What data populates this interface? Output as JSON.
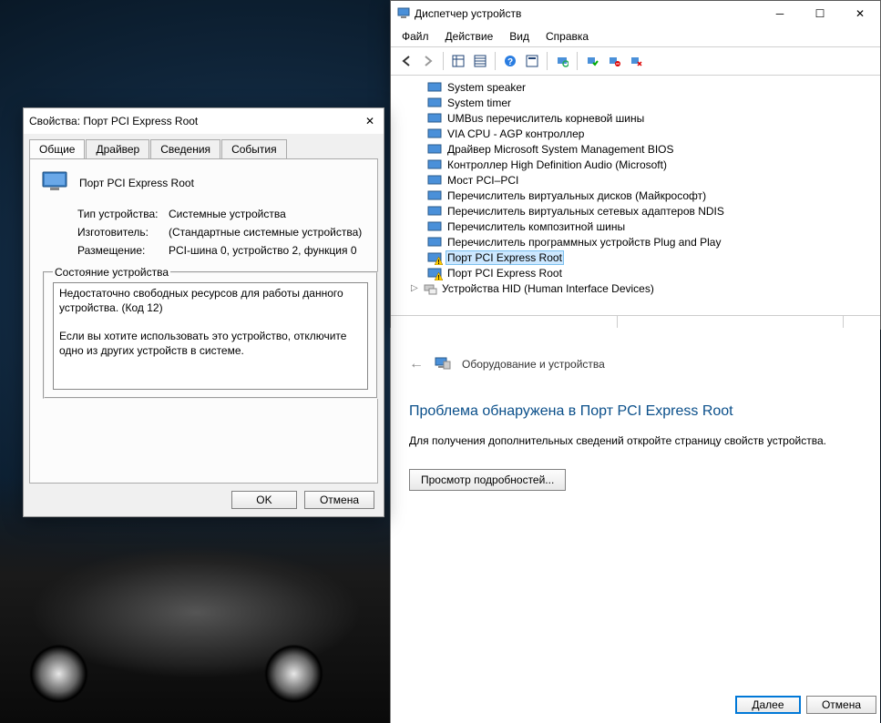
{
  "properties_dialog": {
    "title": "Свойства: Порт PCI Express Root",
    "tabs": [
      "Общие",
      "Драйвер",
      "Сведения",
      "События"
    ],
    "device_name": "Порт PCI Express Root",
    "rows": {
      "type_k": "Тип устройства:",
      "type_v": "Системные устройства",
      "mfr_k": "Изготовитель:",
      "mfr_v": "(Стандартные системные устройства)",
      "loc_k": "Размещение:",
      "loc_v": "PCI-шина 0, устройство 2, функция 0"
    },
    "status_legend": "Состояние устройства",
    "status_line1": "Недостаточно свободных ресурсов для работы данного устройства. (Код 12)",
    "status_line2": "Если вы хотите использовать это устройство, отключите одно из других устройств в системе.",
    "ok": "OK",
    "cancel": "Отмена"
  },
  "devmgr": {
    "title": "Диспетчер устройств",
    "menu": [
      "Файл",
      "Действие",
      "Вид",
      "Справка"
    ],
    "items": [
      "System speaker",
      "System timer",
      "UMBus перечислитель корневой шины",
      "VIA CPU - AGP контроллер",
      "Драйвер Microsoft System Management BIOS",
      "Контроллер High Definition Audio (Microsoft)",
      "Мост PCI–PCI",
      "Перечислитель виртуальных дисков (Майкрософт)",
      "Перечислитель виртуальных сетевых адаптеров NDIS",
      "Перечислитель композитной шины",
      "Перечислитель программных устройств Plug and Play",
      "Порт PCI Express Root",
      "Порт PCI Express Root"
    ],
    "category": "Устройства HID (Human Interface Devices)"
  },
  "troubleshoot": {
    "breadcrumb": "Оборудование и устройства",
    "heading": "Проблема обнаружена в Порт PCI Express Root",
    "msg": "Для получения дополнительных сведений откройте страницу свойств устройства.",
    "details_btn": "Просмотр подробностей...",
    "next": "Далее",
    "cancel": "Отмена"
  }
}
